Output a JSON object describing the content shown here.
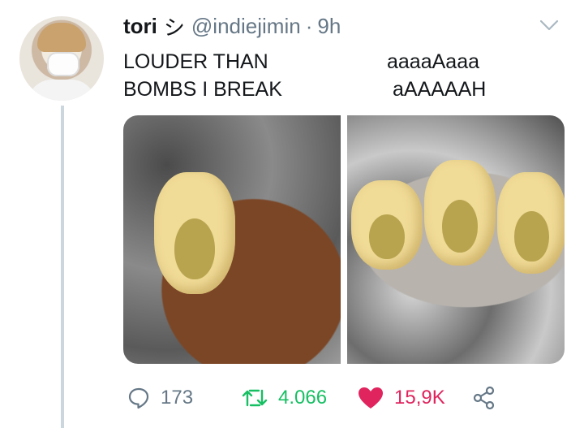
{
  "tweet": {
    "name": "tori",
    "name_symbol": "シ",
    "handle": "@indiejimin",
    "dot": "·",
    "time": "9h",
    "text": {
      "line1_left": "LOUDER THAN",
      "line1_right": "aaaaAaaa",
      "line2_left": "BOMBS I BREAK",
      "line2_right": "aAAAAAH"
    },
    "media": {
      "left_alt": "screaming-pasta-on-wooden-spoon",
      "right_alt": "screaming-pasta-on-metal-spoon"
    },
    "actions": {
      "reply_count": "173",
      "retweet_count": "4.066",
      "like_count": "15,9K"
    }
  },
  "icons": {
    "reply": "reply-icon",
    "retweet": "retweet-icon",
    "like": "heart-icon",
    "share": "share-icon",
    "caret": "chevron-down-icon"
  },
  "colors": {
    "retweet": "#17bf63",
    "like": "#e0245e",
    "secondary_text": "#657786"
  }
}
